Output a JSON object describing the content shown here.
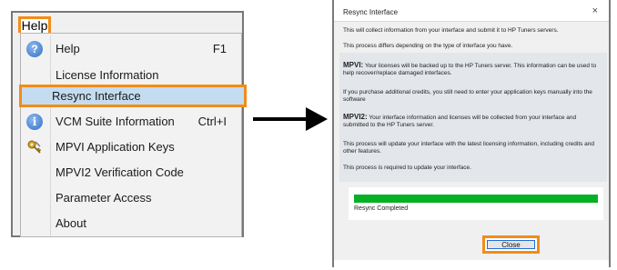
{
  "menu": {
    "menubar_label": "Help",
    "items": [
      {
        "label": "Help",
        "shortcut": "F1",
        "icon": "help-icon"
      },
      {
        "label": "License Information",
        "shortcut": "",
        "icon": ""
      },
      {
        "label": "Resync Interface",
        "shortcut": "",
        "icon": ""
      },
      {
        "label": "VCM Suite Information",
        "shortcut": "Ctrl+I",
        "icon": "info-icon"
      },
      {
        "label": "MPVI Application Keys",
        "shortcut": "",
        "icon": "keys-icon"
      },
      {
        "label": "MPVI2 Verification Code",
        "shortcut": "",
        "icon": ""
      },
      {
        "label": "Parameter Access",
        "shortcut": "",
        "icon": ""
      },
      {
        "label": "About",
        "shortcut": "",
        "icon": ""
      }
    ]
  },
  "dialog": {
    "title": "Resync Interface",
    "close_glyph": "×",
    "p1": "This will collect information from your interface and submit it to HP Tuners servers.",
    "p2": "This process differs depending on the type of interface you have.",
    "mpvi_heading": "MPVI:",
    "mpvi_text": "Your licenses will be backed up to the HP Tuners server. This information can be used to help recover/replace damaged interfaces.",
    "p4": "If you purchase additional credits, you still need to enter your application keys manually into the software",
    "mpvi2_heading": "MPVI2:",
    "mpvi2_text": "Your interface information and licenses will be collected from your interface and submitted to the HP Tuners server.",
    "p6": "This process will update your interface with the latest licensing information, including credits and other features.",
    "p7": "This process is required to update your interface.",
    "progress_percent": 100,
    "progress_text": "Resync Completed",
    "close_button": "Close"
  },
  "colors": {
    "highlight_outline": "#f28c18",
    "selection": "#c4dcf0",
    "progress": "#06b025"
  }
}
